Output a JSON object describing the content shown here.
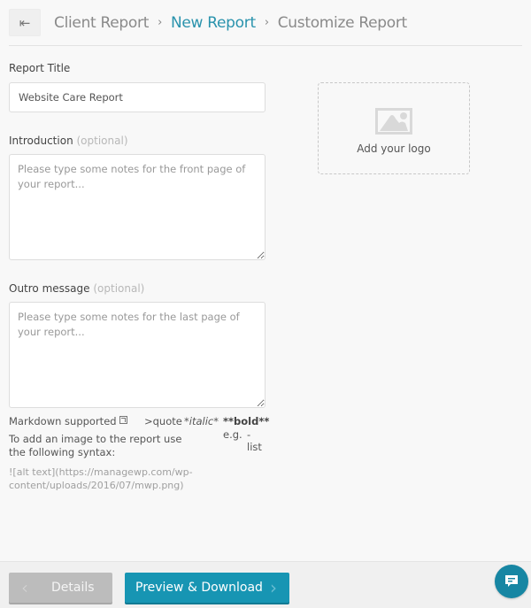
{
  "header": {
    "back_icon": "arrow-left-icon",
    "breadcrumb": [
      "Client Report",
      "New Report",
      "Customize Report"
    ],
    "separator": "›"
  },
  "form": {
    "title": {
      "label": "Report Title",
      "value": "Website Care Report"
    },
    "introduction": {
      "label": "Introduction",
      "optional": "(optional)",
      "placeholder": "Please type some notes for the front page of your report..."
    },
    "outro": {
      "label": "Outro message",
      "optional": "(optional)",
      "placeholder": "Please type some notes for the last page of your report..."
    }
  },
  "logo": {
    "icon": "image-placeholder-icon",
    "label": "Add your logo"
  },
  "markdown": {
    "supported": "Markdown supported",
    "quote": ">quote",
    "italic": "*italic*",
    "bold": "**bold**",
    "eg": "e.g.",
    "list": "- list",
    "help": "To add an image to the report use the following syntax:",
    "syntax": "![alt text](https://managewp.com/wp-content/uploads/2016/07/mwp.png)"
  },
  "footer": {
    "details_label": "Details",
    "preview_label": "Preview & Download",
    "chevron_left": "‹",
    "chevron_right": "›",
    "chat_icon": "chat-icon"
  },
  "colors": {
    "accent": "#1795b3",
    "link": "#2a93ad",
    "disabled": "#bcbcbc"
  }
}
